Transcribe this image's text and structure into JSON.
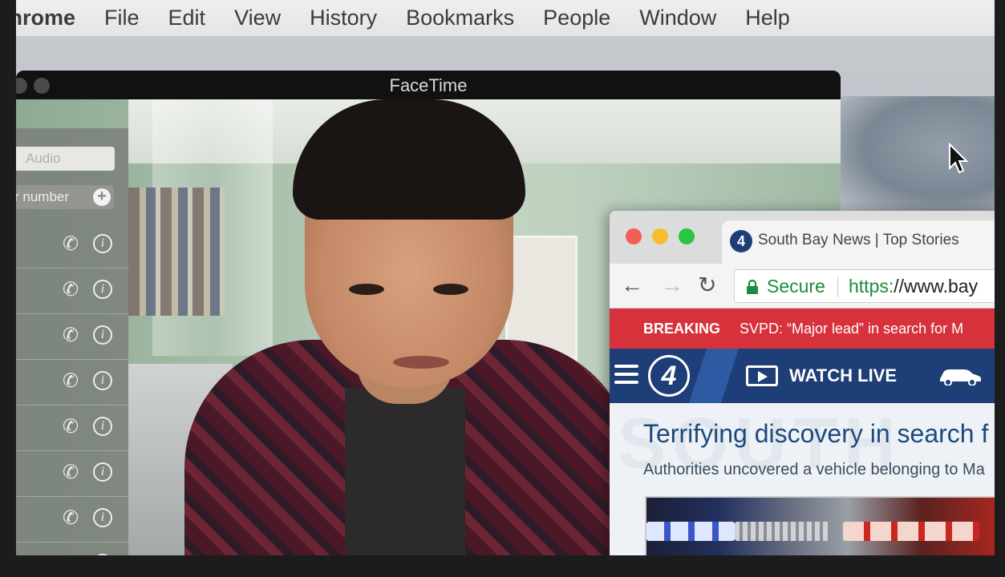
{
  "menubar": {
    "app_name": "Chrome",
    "items": [
      "File",
      "Edit",
      "View",
      "History",
      "Bookmarks",
      "People",
      "Window",
      "Help"
    ]
  },
  "facetime": {
    "title": "FaceTime",
    "audio_placeholder": "Audio",
    "number_placeholder": "r number",
    "contact_rows": 8
  },
  "browser": {
    "tab_title": "South Bay News | Top Stories",
    "favicon_label": "4",
    "secure_label": "Secure",
    "url_scheme": "https:",
    "url_rest": "//www.bay",
    "breaking": {
      "label": "BREAKING",
      "text": "SVPD: “Major lead” in search for M"
    },
    "site": {
      "logo": "4",
      "watch_live": "WATCH LIVE"
    },
    "article": {
      "headline": "Terrifying discovery in search f",
      "subhead": "Authorities uncovered a vehicle belonging to Ma"
    }
  },
  "colors": {
    "breaking_red": "#d7323b",
    "nav_blue": "#1d3e76",
    "secure_green": "#1c8c3a"
  }
}
